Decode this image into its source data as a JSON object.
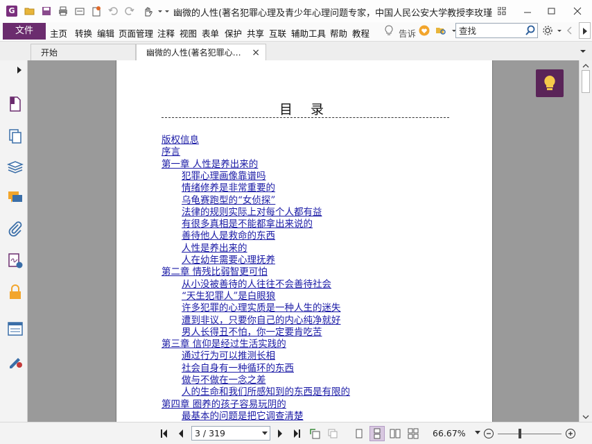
{
  "window": {
    "title": "幽微的人性(著名犯罪心理及青少年心理问题专家，中国人民公安大学教授李玫瑾，…",
    "app_logo": "G"
  },
  "menu": {
    "file": "文件",
    "items": [
      "主页",
      "转换",
      "编辑",
      "页面管理",
      "注释",
      "视图",
      "表单",
      "保护",
      "共享",
      "互联",
      "辅助工具",
      "帮助",
      "教程"
    ],
    "tell_me": "告诉"
  },
  "search": {
    "placeholder": "查找"
  },
  "tabs": [
    {
      "label": "开始"
    },
    {
      "label": "幽微的人性(著名犯罪心…",
      "close": "×"
    }
  ],
  "document": {
    "toc_title": "目 录",
    "entries": [
      {
        "level": 1,
        "text": "版权信息"
      },
      {
        "level": 1,
        "text": "序言"
      },
      {
        "level": 1,
        "text": "第一章 人性是养出来的"
      },
      {
        "level": 2,
        "text": "犯罪心理画像靠谱吗"
      },
      {
        "level": 2,
        "text": "情绪修养是非常重要的"
      },
      {
        "level": 2,
        "text": "乌龟赛跑型的“女侦探”"
      },
      {
        "level": 2,
        "text": "法律的规则实际上对每个人都有益"
      },
      {
        "level": 2,
        "text": "有很多真相是不能都拿出来说的"
      },
      {
        "level": 2,
        "text": "善待他人是救命的东西"
      },
      {
        "level": 2,
        "text": "人性是养出来的"
      },
      {
        "level": 2,
        "text": "人在幼年需要心理抚养"
      },
      {
        "level": 1,
        "text": "第二章 情残比弱智更可怕"
      },
      {
        "level": 2,
        "text": "从小没被善待的人往往不会善待社会"
      },
      {
        "level": 2,
        "text": "“天生犯罪人”是白眼狼"
      },
      {
        "level": 2,
        "text": "许多犯罪的心理实质是一种人生的迷失"
      },
      {
        "level": 2,
        "text": "遭到非议，只要你自己的内心纯净就好"
      },
      {
        "level": 2,
        "text": "男人长得丑不怕，你一定要肯吃苦"
      },
      {
        "level": 1,
        "text": "第三章 信仰是经过生活实践的"
      },
      {
        "level": 2,
        "text": "通过行为可以推测长相"
      },
      {
        "level": 2,
        "text": "社会自身有一种循环的东西"
      },
      {
        "level": 2,
        "text": "做与不做在一念之差"
      },
      {
        "level": 2,
        "text": "人的生命和我们所感知到的东西是有限的"
      },
      {
        "level": 1,
        "text": "第四章 圈养的孩子容易玩阴的"
      },
      {
        "level": 2,
        "text": "最基本的问题是把它调查清楚"
      }
    ]
  },
  "status": {
    "page_indicator": "3 / 319",
    "zoom": "66.67%"
  },
  "colors": {
    "accent": "#6b2c6e",
    "link": "#1a1aa6",
    "doc_bg": "#9a9a9a"
  },
  "icons": [
    "logo-icon",
    "open-folder-icon",
    "save-icon",
    "print-icon",
    "scan-icon",
    "new-icon",
    "undo-icon",
    "redo-icon",
    "hand-icon",
    "lightbulb-icon",
    "heart-icon",
    "search-icon",
    "gear-icon",
    "page-icon",
    "pages-icon",
    "layers-icon",
    "comment-icon",
    "attachment-icon",
    "signature-icon",
    "lock-icon",
    "form-icon",
    "sign-pen-icon"
  ]
}
